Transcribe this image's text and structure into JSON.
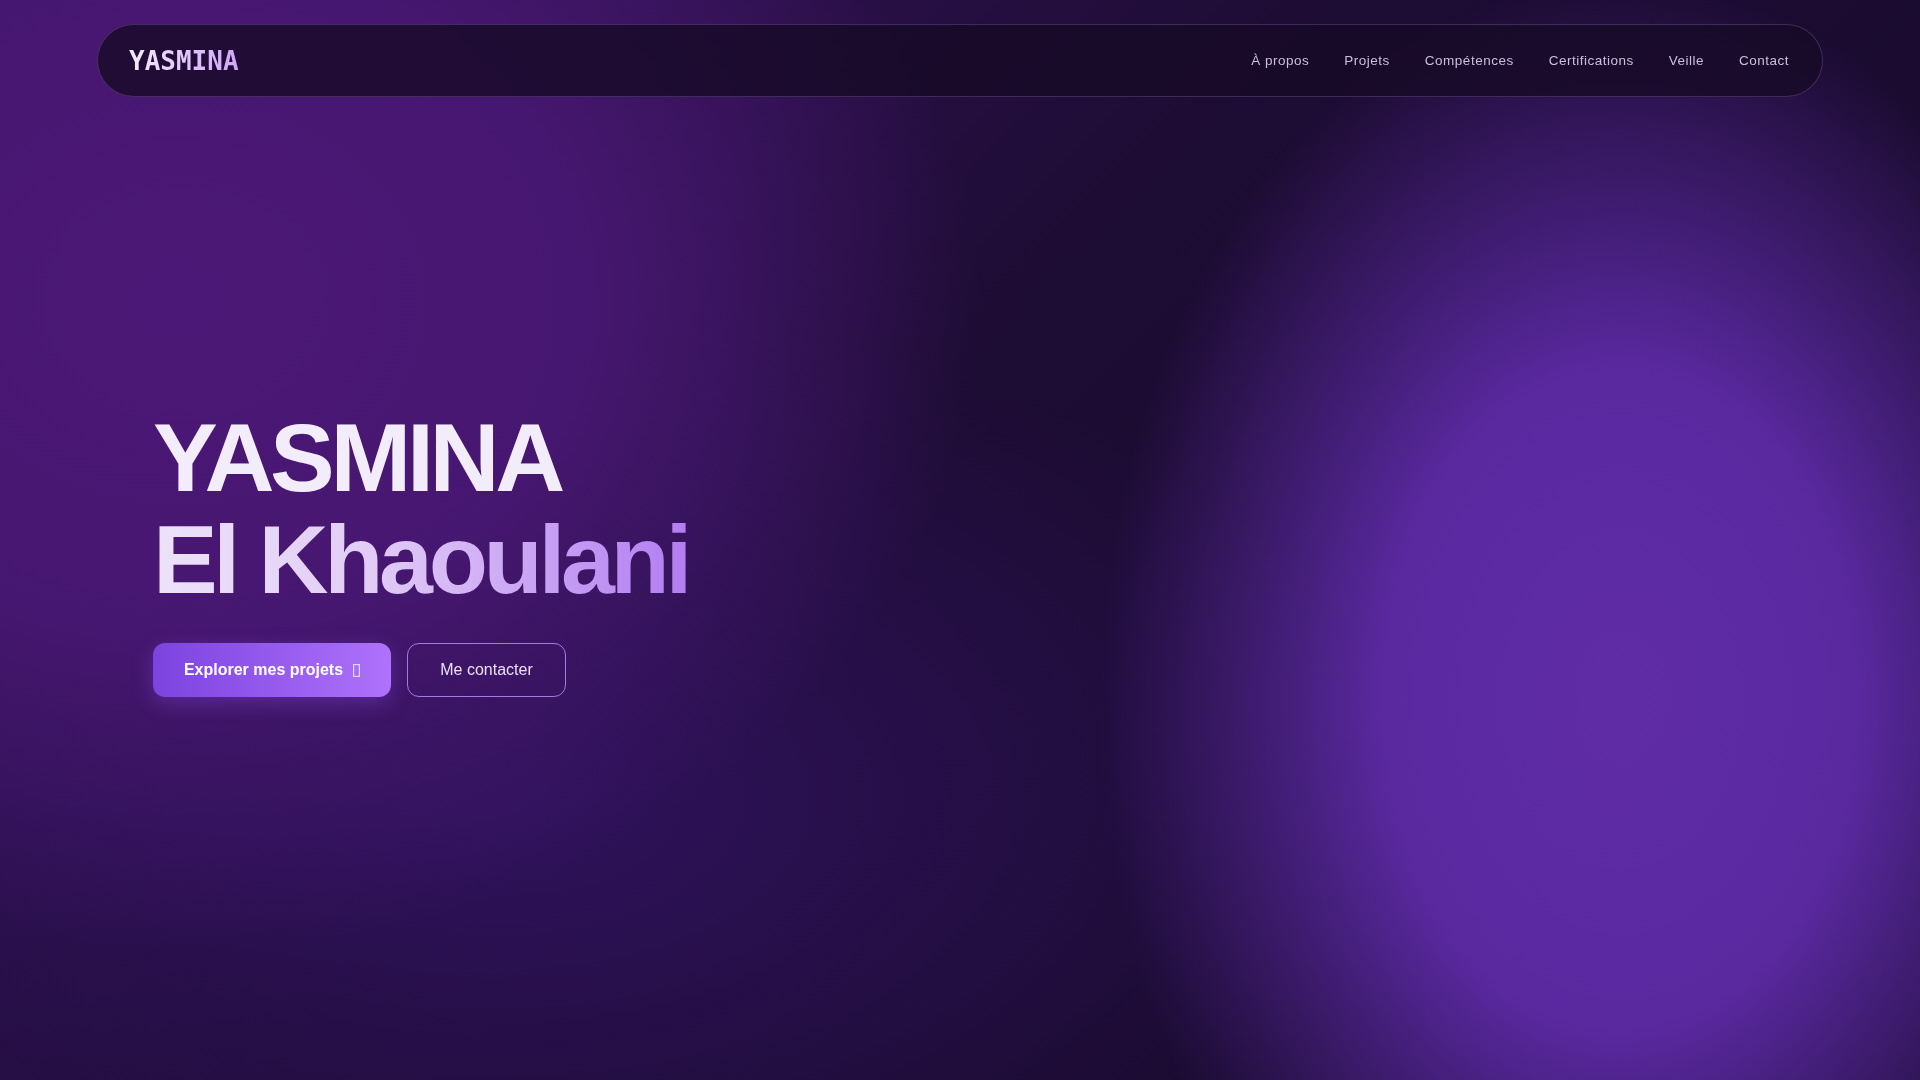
{
  "navbar": {
    "logo": "YASMINA",
    "links": [
      {
        "label": "À propos"
      },
      {
        "label": "Projets"
      },
      {
        "label": "Compétences"
      },
      {
        "label": "Certifications"
      },
      {
        "label": "Veille"
      },
      {
        "label": "Contact"
      }
    ]
  },
  "hero": {
    "first_name": "YASMINA",
    "last_name": "El Khaoulani",
    "buttons": [
      {
        "kind": "primary",
        "label": "Explorer mes projets"
      },
      {
        "kind": "outline",
        "label": "Me contacter"
      }
    ]
  }
}
